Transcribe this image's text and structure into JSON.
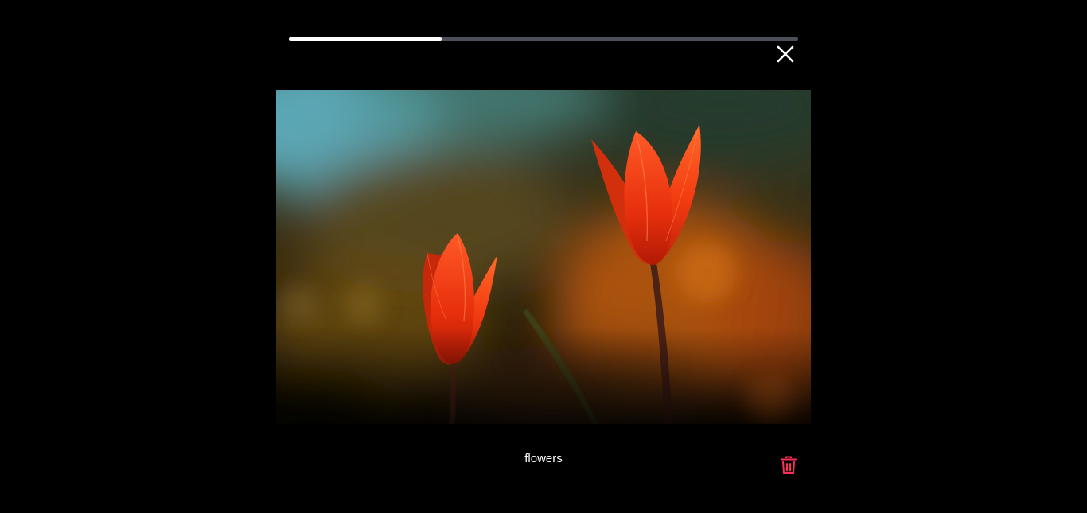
{
  "story": {
    "caption": "flowers",
    "progress": 0.3
  },
  "icons": {
    "close": "close-icon",
    "delete": "trash-icon"
  },
  "colors": {
    "background": "#000000",
    "progress_fill": "#ffffff",
    "progress_track": "#4b4f57",
    "delete_accent": "#ff2e57"
  }
}
